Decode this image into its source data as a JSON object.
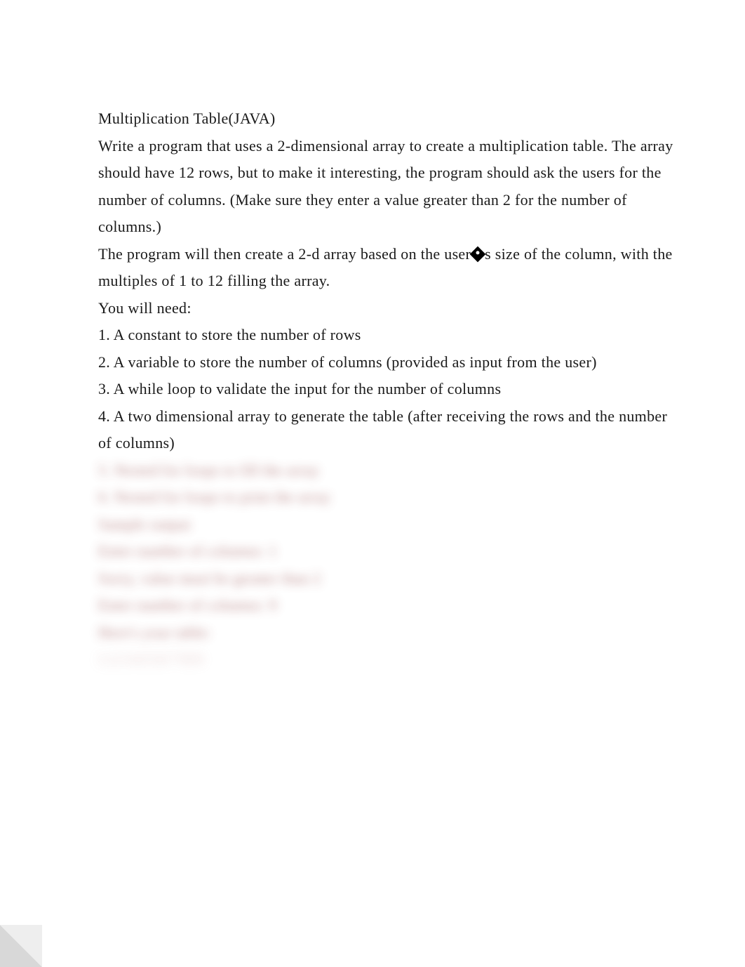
{
  "content": {
    "title": "Multiplication Table(JAVA)",
    "p1a": " Write a program that uses a 2-dimensional array to create a multiplication table. The array",
    "p1b": " should have 12 rows, but to make it interesting, the program should ask the users for the",
    "p1c": " number of columns. (Make sure they enter a value greater than 2 for the number of columns.)",
    "p1d_pre": " The program will then create a 2-d array based on the user",
    "p1d_post": "s size of the column, with the",
    "p1e": " multiples of 1 to 12 filling the array.",
    "need": " You will need:",
    "item1": " 1. A constant to store the number of rows",
    "item2": " 2. A variable to store the number of columns (provided as input from the user)",
    "item3": " 3. A while loop to validate the input for the number of columns",
    "item4": " 4. A two dimensional array to generate the table (after receiving the rows and the number",
    "item4b": " of columns)",
    "blur1": " 5. Nested for loops to fill the array",
    "blur2": " 6. Nested for loops to print the array",
    "blur3": " Sample output",
    "blur4": " Enter number of columns: 1",
    "blur5": " Sorry, value must be greater than 2",
    "blur6": " Enter number of columns: 9",
    "blur7": " Here's your table:",
    "blur8": " 1 2 3 4 5 6 7 8 9"
  }
}
